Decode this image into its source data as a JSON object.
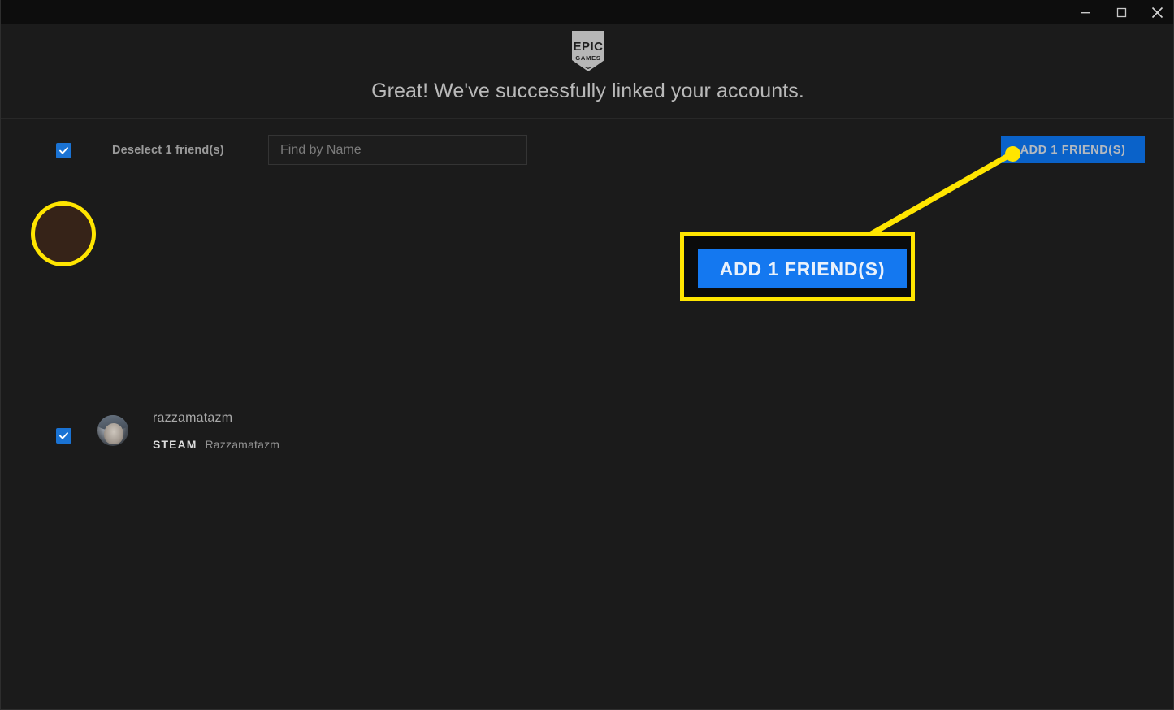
{
  "window": {
    "controls": [
      {
        "name": "minimize",
        "icon": "minimize-icon",
        "label": "Minimize"
      },
      {
        "name": "maximize",
        "icon": "maximize-icon",
        "label": "Maximize"
      },
      {
        "name": "close",
        "icon": "close-icon",
        "label": "Close"
      }
    ]
  },
  "header": {
    "logo": {
      "icon": "epic-games-logo",
      "line1": "EPIC",
      "line2": "GAMES"
    },
    "headline": "Great! We've successfully linked your accounts."
  },
  "toolbar": {
    "select_all_checked": true,
    "deselect_label": "Deselect 1 friend(s)",
    "search": {
      "value": "",
      "placeholder": "Find by Name"
    },
    "add_button_label": "ADD 1 FRIEND(S)"
  },
  "friends": [
    {
      "checked": true,
      "display_name": "razzamatazm",
      "platform": "STEAM",
      "platform_name": "Razzamatazm"
    }
  ],
  "annotations": {
    "callout_button_label": "ADD 1 FRIEND(S)",
    "highlight_color": "#ffe500",
    "ring_target": "friend-checkbox",
    "callout_target": "add-friends-button"
  },
  "colors": {
    "accent_blue": "#0a62c9",
    "callout_blue": "#1478f0",
    "checkbox_blue": "#1a73d4",
    "highlight_yellow": "#ffe500",
    "app_background": "#1b1b1b",
    "titlebar_background": "#0d0d0d"
  }
}
